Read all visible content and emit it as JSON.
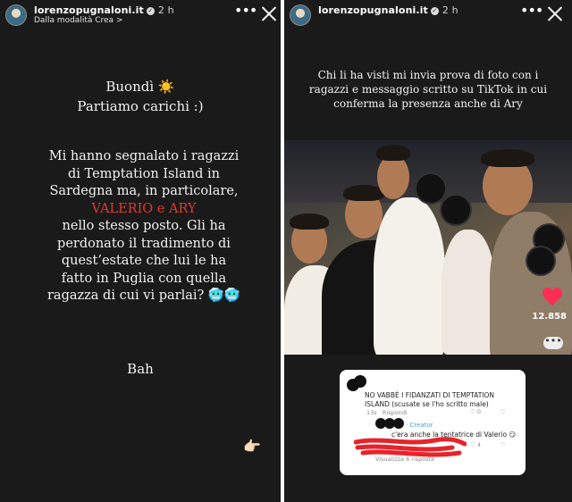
{
  "left_story": {
    "username": "lorenzopugnaloni.it",
    "time": "2 h",
    "subtitle": "Dalla modalità Crea",
    "subtitle_chevron": ">",
    "more": "•••",
    "greeting_line1": "Buondì ☀️",
    "greeting_line2": "Partiamo carichi :)",
    "body_part1": "Mi hanno segnalato i ragazzi di Temptation Island in Sardegna ma, in particolare,",
    "body_highlight": "VALERIO e ARY",
    "body_part2": "nello stesso posto. Gli ha perdonato il tradimento di quest’estate che lui le ha fatto in Puglia con quella ragazza di cui vi parlai? 🥶🥶",
    "closing": "Bah",
    "hand_emoji": "👉🏻",
    "highlight_color": "#e03a2f"
  },
  "right_story": {
    "username": "lorenzopugnaloni.it",
    "time": "2 h",
    "more": "•••",
    "caption": "Chi li ha visti mi invia prova di foto con i ragazzi e messaggio scritto su TikTok in cui conferma la presenza anche di Ary",
    "likes": "12.858",
    "comment_card": {
      "comment": "NO VABBÈ I FIDANZATI DI TEMPTATION ISLAND (scusate se l'ho scritto male)",
      "comment_age": "13s",
      "reply_label": "Rispondi",
      "comment_likes": "0",
      "creator_label": "· Creator",
      "reply_text": "c'era anche la tentatrice di Valerio 😏",
      "reply_likes": "4",
      "view_replies": "Visualizza 6 risposte"
    }
  }
}
